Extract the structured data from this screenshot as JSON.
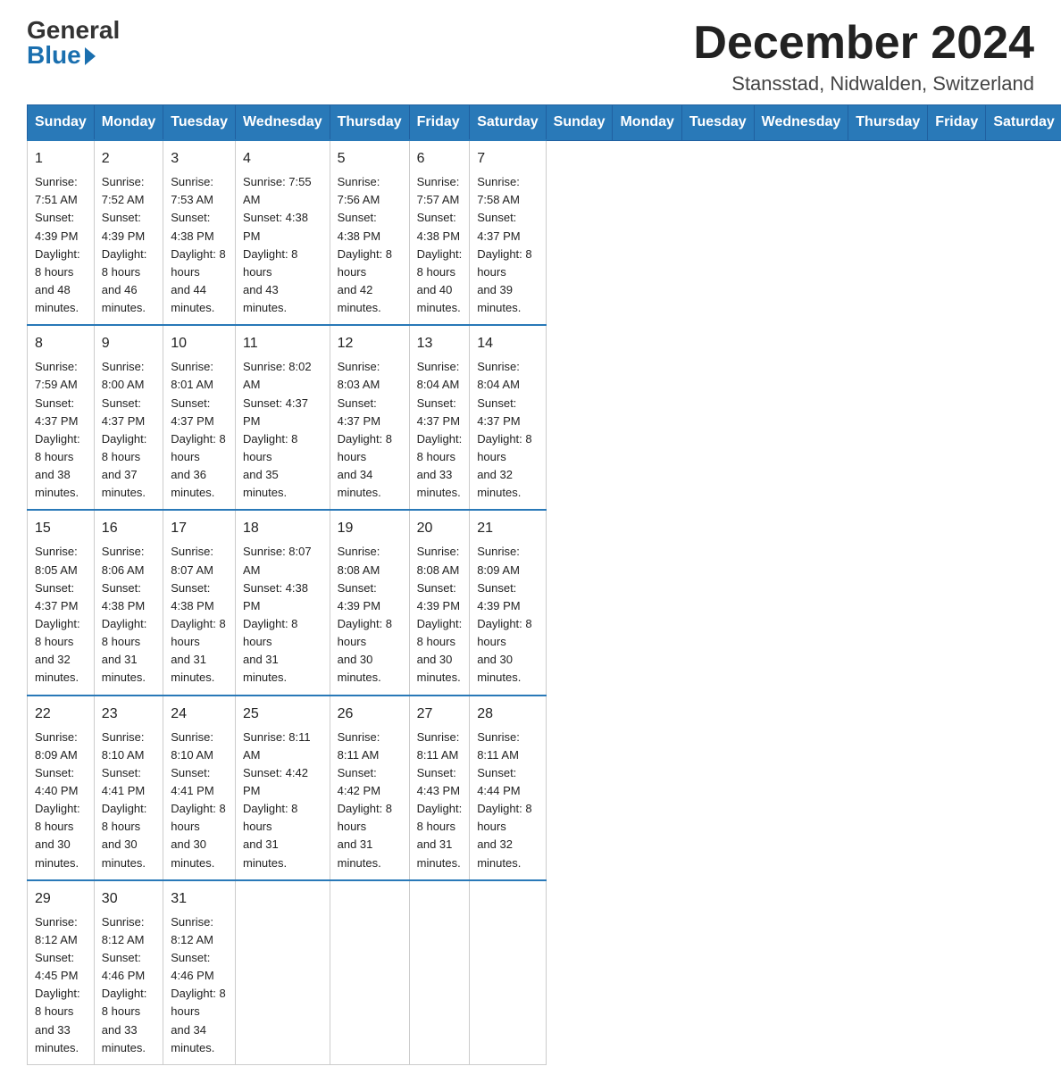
{
  "header": {
    "logo_general": "General",
    "logo_blue": "Blue",
    "month_year": "December 2024",
    "location": "Stansstad, Nidwalden, Switzerland"
  },
  "days_of_week": [
    "Sunday",
    "Monday",
    "Tuesday",
    "Wednesday",
    "Thursday",
    "Friday",
    "Saturday"
  ],
  "weeks": [
    [
      {
        "day": "1",
        "info": "Sunrise: 7:51 AM\nSunset: 4:39 PM\nDaylight: 8 hours\nand 48 minutes."
      },
      {
        "day": "2",
        "info": "Sunrise: 7:52 AM\nSunset: 4:39 PM\nDaylight: 8 hours\nand 46 minutes."
      },
      {
        "day": "3",
        "info": "Sunrise: 7:53 AM\nSunset: 4:38 PM\nDaylight: 8 hours\nand 44 minutes."
      },
      {
        "day": "4",
        "info": "Sunrise: 7:55 AM\nSunset: 4:38 PM\nDaylight: 8 hours\nand 43 minutes."
      },
      {
        "day": "5",
        "info": "Sunrise: 7:56 AM\nSunset: 4:38 PM\nDaylight: 8 hours\nand 42 minutes."
      },
      {
        "day": "6",
        "info": "Sunrise: 7:57 AM\nSunset: 4:38 PM\nDaylight: 8 hours\nand 40 minutes."
      },
      {
        "day": "7",
        "info": "Sunrise: 7:58 AM\nSunset: 4:37 PM\nDaylight: 8 hours\nand 39 minutes."
      }
    ],
    [
      {
        "day": "8",
        "info": "Sunrise: 7:59 AM\nSunset: 4:37 PM\nDaylight: 8 hours\nand 38 minutes."
      },
      {
        "day": "9",
        "info": "Sunrise: 8:00 AM\nSunset: 4:37 PM\nDaylight: 8 hours\nand 37 minutes."
      },
      {
        "day": "10",
        "info": "Sunrise: 8:01 AM\nSunset: 4:37 PM\nDaylight: 8 hours\nand 36 minutes."
      },
      {
        "day": "11",
        "info": "Sunrise: 8:02 AM\nSunset: 4:37 PM\nDaylight: 8 hours\nand 35 minutes."
      },
      {
        "day": "12",
        "info": "Sunrise: 8:03 AM\nSunset: 4:37 PM\nDaylight: 8 hours\nand 34 minutes."
      },
      {
        "day": "13",
        "info": "Sunrise: 8:04 AM\nSunset: 4:37 PM\nDaylight: 8 hours\nand 33 minutes."
      },
      {
        "day": "14",
        "info": "Sunrise: 8:04 AM\nSunset: 4:37 PM\nDaylight: 8 hours\nand 32 minutes."
      }
    ],
    [
      {
        "day": "15",
        "info": "Sunrise: 8:05 AM\nSunset: 4:37 PM\nDaylight: 8 hours\nand 32 minutes."
      },
      {
        "day": "16",
        "info": "Sunrise: 8:06 AM\nSunset: 4:38 PM\nDaylight: 8 hours\nand 31 minutes."
      },
      {
        "day": "17",
        "info": "Sunrise: 8:07 AM\nSunset: 4:38 PM\nDaylight: 8 hours\nand 31 minutes."
      },
      {
        "day": "18",
        "info": "Sunrise: 8:07 AM\nSunset: 4:38 PM\nDaylight: 8 hours\nand 31 minutes."
      },
      {
        "day": "19",
        "info": "Sunrise: 8:08 AM\nSunset: 4:39 PM\nDaylight: 8 hours\nand 30 minutes."
      },
      {
        "day": "20",
        "info": "Sunrise: 8:08 AM\nSunset: 4:39 PM\nDaylight: 8 hours\nand 30 minutes."
      },
      {
        "day": "21",
        "info": "Sunrise: 8:09 AM\nSunset: 4:39 PM\nDaylight: 8 hours\nand 30 minutes."
      }
    ],
    [
      {
        "day": "22",
        "info": "Sunrise: 8:09 AM\nSunset: 4:40 PM\nDaylight: 8 hours\nand 30 minutes."
      },
      {
        "day": "23",
        "info": "Sunrise: 8:10 AM\nSunset: 4:41 PM\nDaylight: 8 hours\nand 30 minutes."
      },
      {
        "day": "24",
        "info": "Sunrise: 8:10 AM\nSunset: 4:41 PM\nDaylight: 8 hours\nand 30 minutes."
      },
      {
        "day": "25",
        "info": "Sunrise: 8:11 AM\nSunset: 4:42 PM\nDaylight: 8 hours\nand 31 minutes."
      },
      {
        "day": "26",
        "info": "Sunrise: 8:11 AM\nSunset: 4:42 PM\nDaylight: 8 hours\nand 31 minutes."
      },
      {
        "day": "27",
        "info": "Sunrise: 8:11 AM\nSunset: 4:43 PM\nDaylight: 8 hours\nand 31 minutes."
      },
      {
        "day": "28",
        "info": "Sunrise: 8:11 AM\nSunset: 4:44 PM\nDaylight: 8 hours\nand 32 minutes."
      }
    ],
    [
      {
        "day": "29",
        "info": "Sunrise: 8:12 AM\nSunset: 4:45 PM\nDaylight: 8 hours\nand 33 minutes."
      },
      {
        "day": "30",
        "info": "Sunrise: 8:12 AM\nSunset: 4:46 PM\nDaylight: 8 hours\nand 33 minutes."
      },
      {
        "day": "31",
        "info": "Sunrise: 8:12 AM\nSunset: 4:46 PM\nDaylight: 8 hours\nand 34 minutes."
      },
      {
        "day": "",
        "info": ""
      },
      {
        "day": "",
        "info": ""
      },
      {
        "day": "",
        "info": ""
      },
      {
        "day": "",
        "info": ""
      }
    ]
  ]
}
